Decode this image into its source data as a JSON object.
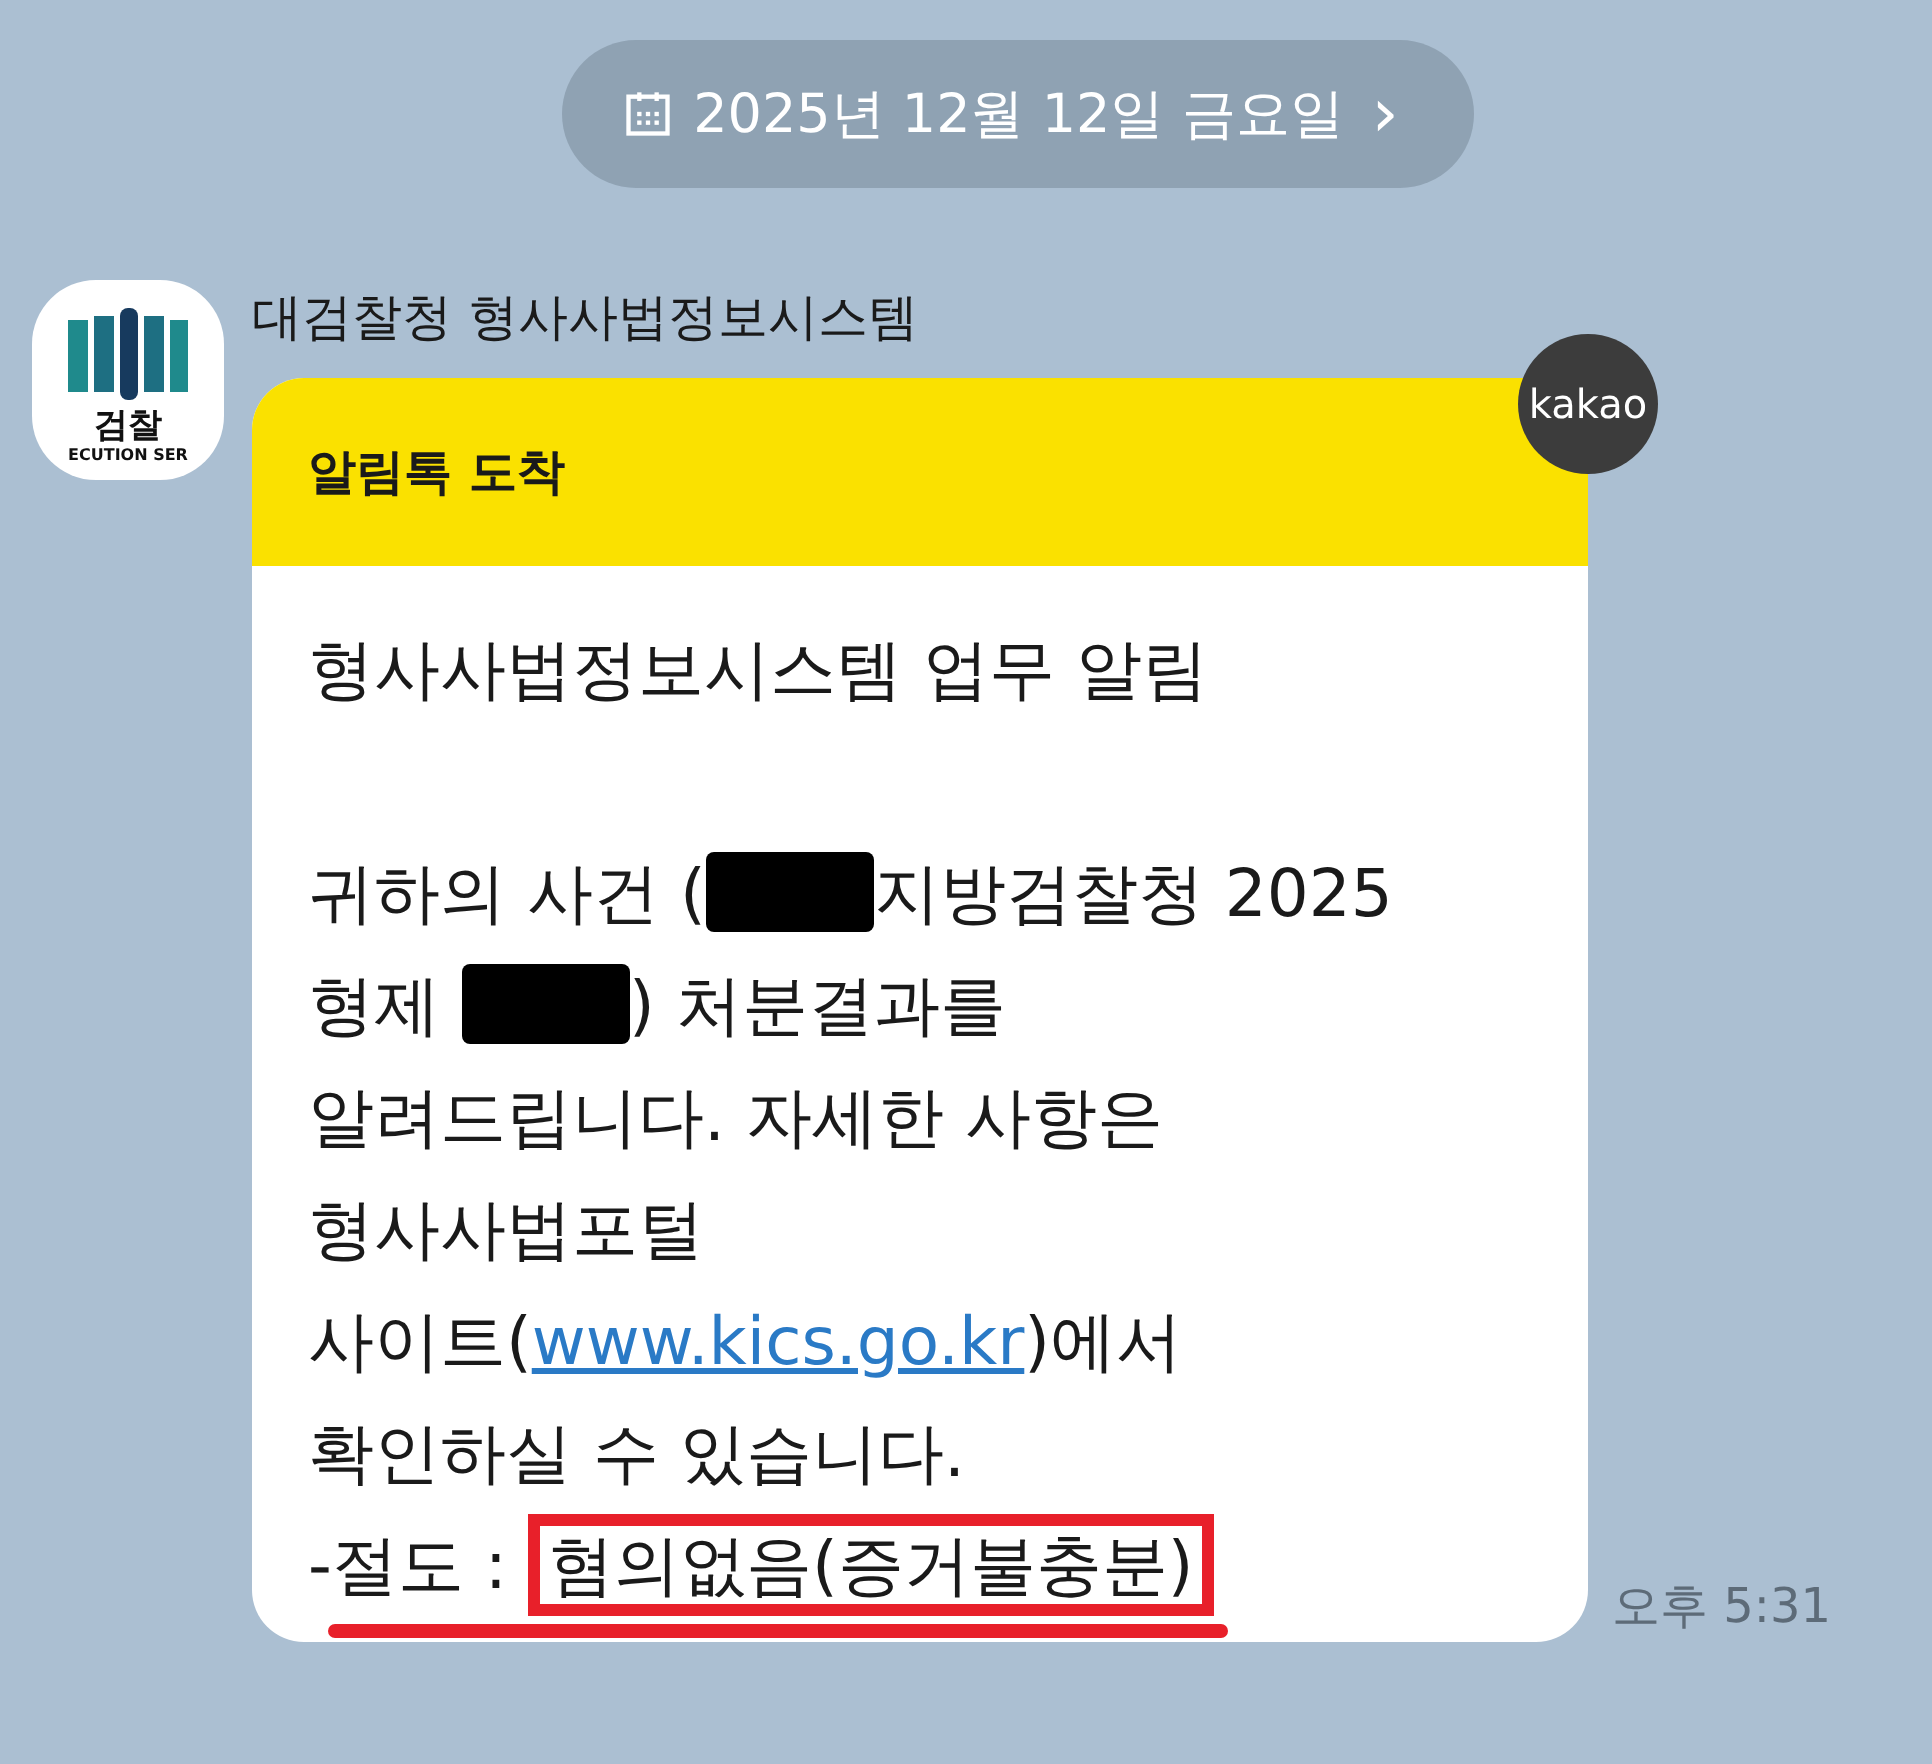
{
  "date_divider": {
    "label": "2025년 12월 12일 금요일",
    "chevron": "›"
  },
  "message": {
    "sender": "대검찰청 형사사법정보시스템",
    "avatar": {
      "title": "검찰",
      "subtitle": "ECUTION SER"
    },
    "badge": "kakao",
    "header": "알림톡 도착",
    "title": "형사사법정보시스템 업무 알림",
    "lines": [
      [
        {
          "kind": "text",
          "text": "귀하의 사건 ("
        },
        {
          "kind": "redacted"
        },
        {
          "kind": "text",
          "text": "지방검찰청 2025"
        }
      ],
      [
        {
          "kind": "text",
          "text": "형제 "
        },
        {
          "kind": "redacted"
        },
        {
          "kind": "text",
          "text": ") 처분결과를"
        }
      ],
      [
        {
          "kind": "text",
          "text": "알려드립니다. 자세한 사항은"
        }
      ],
      [
        {
          "kind": "text",
          "text": "형사사법포털"
        }
      ],
      [
        {
          "kind": "text",
          "text": "사이트("
        },
        {
          "kind": "link",
          "text": "www.kics.go.kr"
        },
        {
          "kind": "text",
          "text": ")에서"
        }
      ],
      [
        {
          "kind": "text",
          "text": "확인하실 수 있습니다."
        }
      ],
      [
        {
          "kind": "text",
          "text": "-절도 : "
        },
        {
          "kind": "boxed",
          "text": "혐의없음(증거불충분)"
        }
      ]
    ],
    "underlined": true,
    "time": "오후 5:31"
  }
}
